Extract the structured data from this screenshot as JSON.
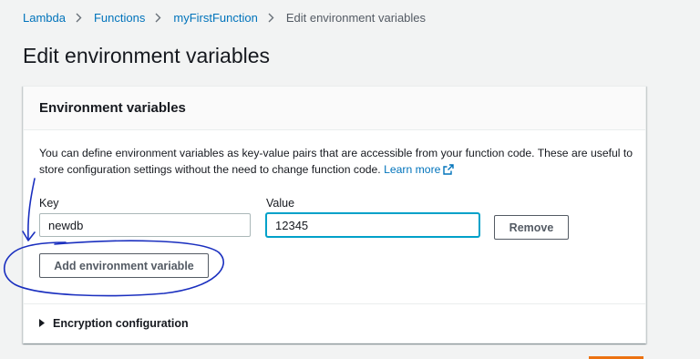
{
  "breadcrumb": {
    "items": [
      "Lambda",
      "Functions",
      "myFirstFunction"
    ],
    "current": "Edit environment variables"
  },
  "page": {
    "title": "Edit environment variables"
  },
  "panel": {
    "title": "Environment variables",
    "description": "You can define environment variables as key-value pairs that are accessible from your function code. These are useful to store configuration settings without the need to change function code.",
    "learn_more": "Learn more",
    "key_label": "Key",
    "value_label": "Value",
    "key_value": "newdb",
    "value_value": "12345",
    "remove_label": "Remove",
    "add_label": "Add environment variable",
    "encryption_label": "Encryption configuration"
  },
  "colors": {
    "link": "#0073bb",
    "focus": "#00a1c9",
    "annotation": "#1a2fbf",
    "primary": "#ec7211"
  },
  "icons": [
    "chevron-right-icon",
    "external-link-icon",
    "caret-right-icon"
  ]
}
